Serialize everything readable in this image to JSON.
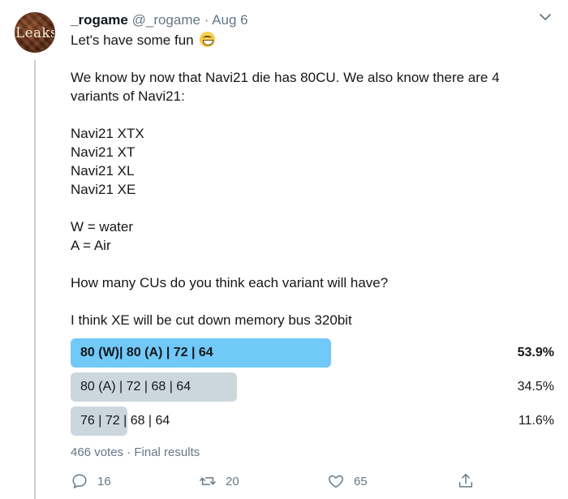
{
  "author": {
    "display_name": "_rogame",
    "handle": "@_rogame",
    "separator": "·",
    "date": "Aug 6",
    "avatar_text": "Leaks"
  },
  "tweet": {
    "first_line": "Let's have some fun",
    "lines": [
      "",
      "We know by now that Navi21 die has 80CU. We also know there are 4",
      "variants of Navi21:",
      "",
      "Navi21 XTX",
      "Navi21 XT",
      "Navi21 XL",
      "Navi21 XE",
      "",
      "W = water",
      "A = Air",
      "",
      "How many CUs do you think each variant will have?",
      "",
      "I think XE will be cut down memory bus 320bit"
    ]
  },
  "poll": {
    "options": [
      {
        "label": "80 (W)| 80 (A) | 72 | 64",
        "percent": "53.9%",
        "share": 0.539,
        "winner": true
      },
      {
        "label": "80 (A) | 72 | 68 | 64",
        "percent": "34.5%",
        "share": 0.345,
        "winner": false
      },
      {
        "label": "76 | 72 | 68 | 64",
        "percent": "11.6%",
        "share": 0.116,
        "winner": false
      }
    ],
    "summary": "466 votes · Final results"
  },
  "actions": {
    "reply_count": "16",
    "retweet_count": "20",
    "like_count": "65"
  },
  "colors": {
    "winner_bar": "#71c9f8",
    "other_bar": "#ccd6dd",
    "muted_text": "#657786"
  }
}
